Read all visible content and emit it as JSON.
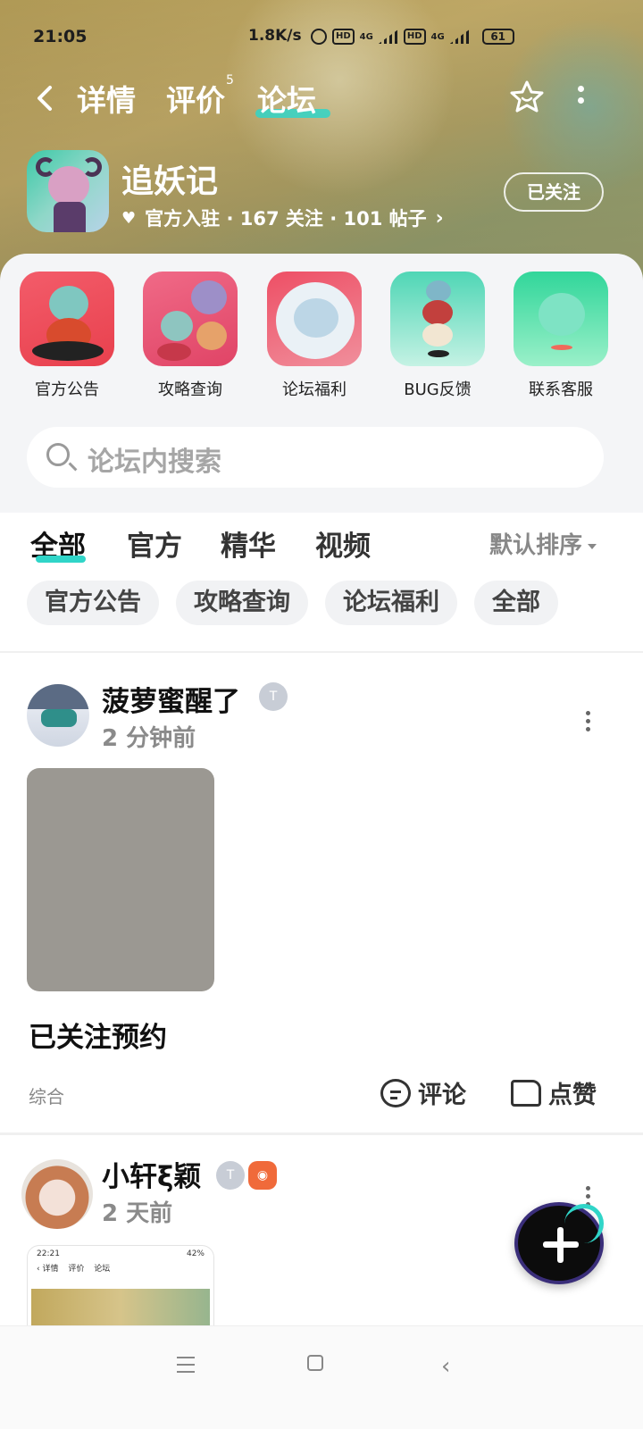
{
  "status_bar": {
    "time": "21:05",
    "network_speed": "1.8K/s",
    "hd1": "HD",
    "net1": "4G",
    "hd2": "HD",
    "net2": "4G",
    "battery": "61"
  },
  "top_nav": {
    "tabs": [
      {
        "label": "详情"
      },
      {
        "label": "评价",
        "superscript": "5"
      },
      {
        "label": "论坛",
        "active": true
      }
    ]
  },
  "game": {
    "title": "追妖记",
    "meta": "官方入驻 · 167 关注 · 101 帖子",
    "follow_label": "已关注"
  },
  "shortcuts": [
    {
      "label": "官方公告"
    },
    {
      "label": "攻略查询"
    },
    {
      "label": "论坛福利"
    },
    {
      "label": "BUG反馈"
    },
    {
      "label": "联系客服"
    }
  ],
  "search": {
    "placeholder": "论坛内搜索"
  },
  "feed_tabs": [
    {
      "label": "全部",
      "active": true
    },
    {
      "label": "官方"
    },
    {
      "label": "精华"
    },
    {
      "label": "视频"
    }
  ],
  "sort_label": "默认排序",
  "filter_chips": [
    "官方公告",
    "攻略查询",
    "论坛福利",
    "全部"
  ],
  "posts": [
    {
      "username": "菠萝蜜醒了",
      "time": "2 分钟前",
      "content": "已关注预约",
      "tag": "综合",
      "comment_label": "评论",
      "like_label": "点赞"
    },
    {
      "username": "小轩ξ颖",
      "time": "2 天前",
      "thumb_time": "22:21",
      "thumb_status": "42%",
      "thumb_tabs": [
        "详情",
        "评价",
        "论坛"
      ]
    }
  ],
  "accent_color": "#30d5c8"
}
